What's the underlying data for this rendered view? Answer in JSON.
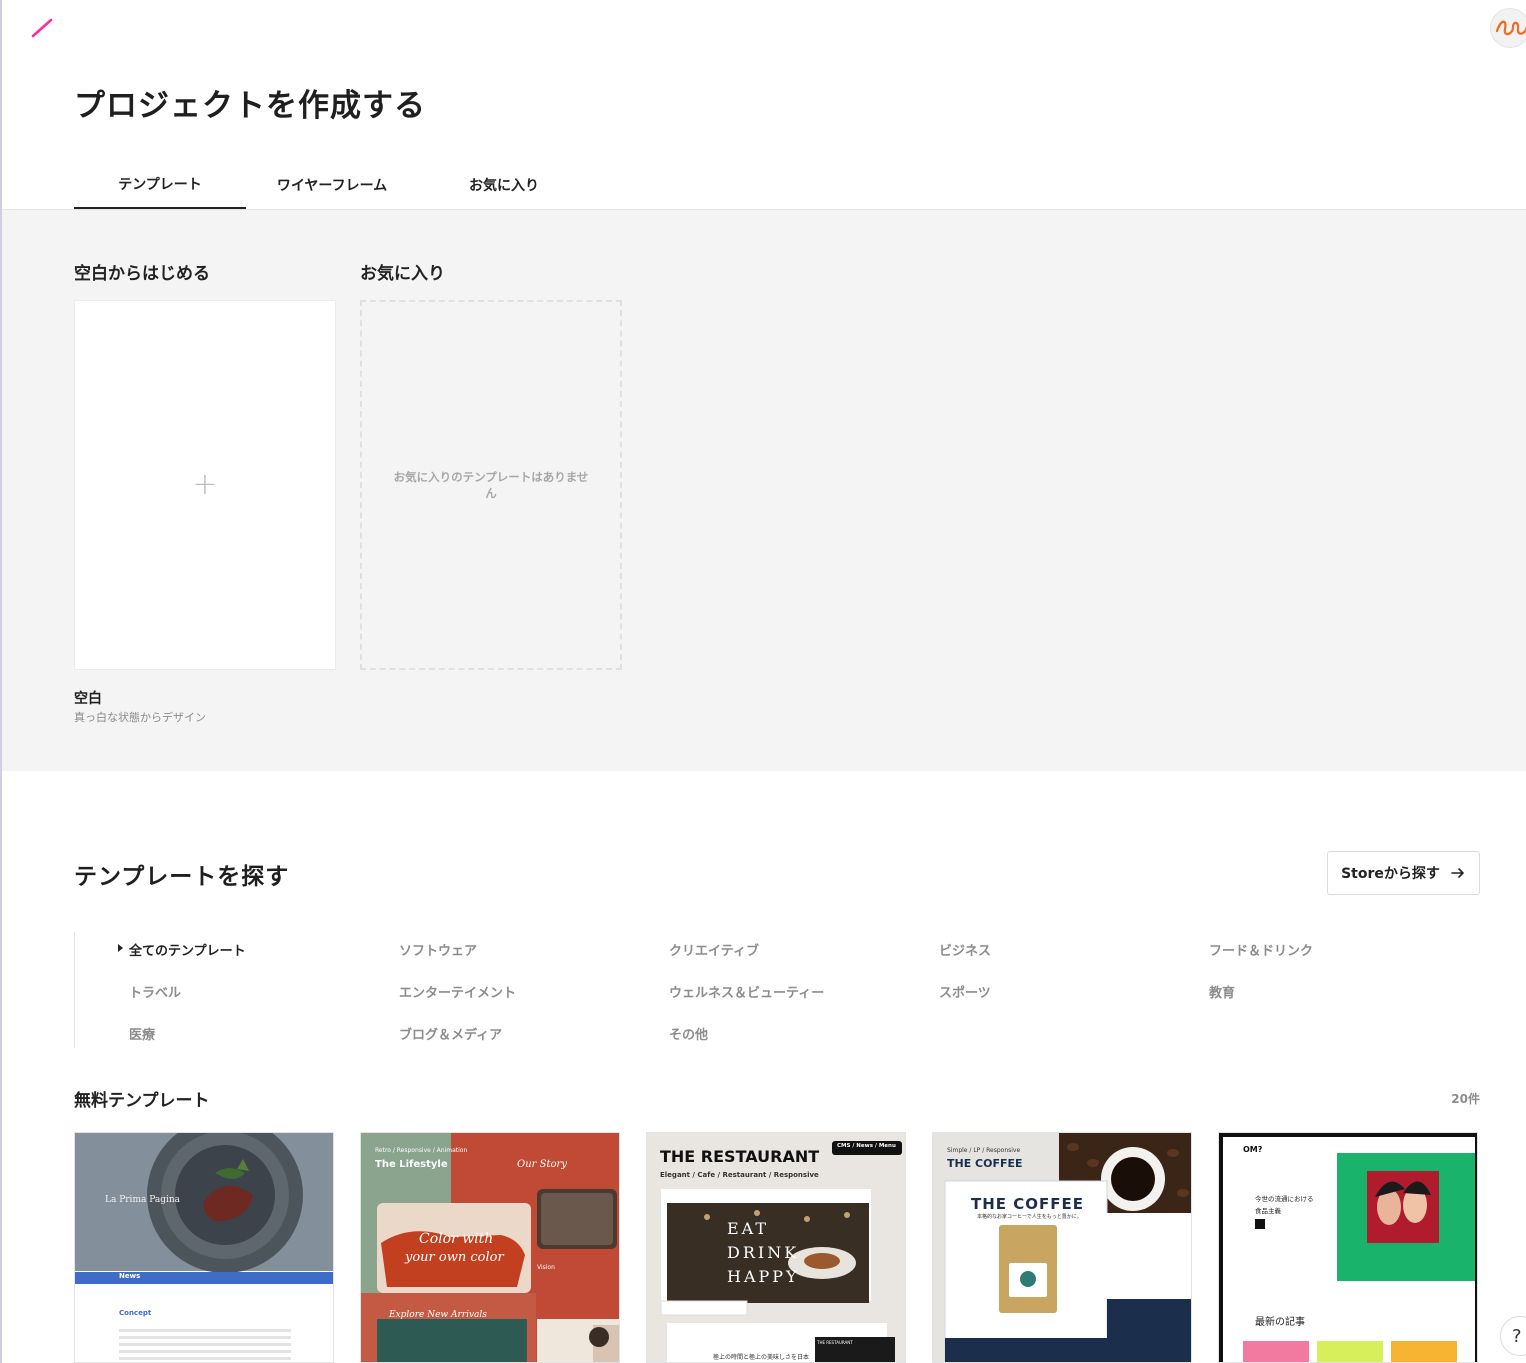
{
  "header": {
    "title": "プロジェクトを作成する"
  },
  "colors": {
    "logo_accent": "#ff2d9b",
    "avatar_accent": "#f26a1b",
    "gray_band": "#f4f4f4"
  },
  "tabs": [
    {
      "label": "テンプレート",
      "active": true
    },
    {
      "label": "ワイヤーフレーム",
      "active": false
    },
    {
      "label": "お気に入り",
      "active": false
    }
  ],
  "start_section": {
    "heading": "空白からはじめる",
    "card_icon": "plus-icon",
    "card_title": "空白",
    "card_subtitle": "真っ白な状態からデザイン"
  },
  "favorites_section": {
    "heading": "お気に入り",
    "empty_text": "お気に入りのテンプレートはありません"
  },
  "explore": {
    "title": "テンプレートを探す",
    "store_button": "Storeから探す",
    "store_icon": "arrow-right-icon"
  },
  "categories": [
    {
      "label": "全てのテンプレート",
      "active": true
    },
    {
      "label": "ソフトウェア"
    },
    {
      "label": "クリエイティブ"
    },
    {
      "label": "ビジネス"
    },
    {
      "label": "フード＆ドリンク"
    },
    {
      "label": "トラベル"
    },
    {
      "label": "エンターテイメント"
    },
    {
      "label": "ウェルネス＆ビューティー"
    },
    {
      "label": "スポーツ"
    },
    {
      "label": "教育"
    },
    {
      "label": "医療"
    },
    {
      "label": "ブログ＆メディア"
    },
    {
      "label": "その他"
    }
  ],
  "free_templates": {
    "title": "無料テンプレート",
    "count": "20件",
    "items": [
      {
        "brand": "La Prima Pagina",
        "news_label": "News",
        "section": "Concept"
      },
      {
        "tags": "Retro / Responsive / Animation",
        "title": "The Lifestyle",
        "script_1": "Color with",
        "script_2": "your own color",
        "script_3": "Our Story",
        "script_4": "Explore New Arrivals",
        "script_5": "Vision"
      },
      {
        "title": "THE RESTAURANT",
        "tags": "Elegant / Cafe / Restaurant / Responsive",
        "badge": "CMS / News / Menu",
        "hero_1": "EAT",
        "hero_2": "DRINK",
        "hero_3": "HAPPY",
        "caption": "極上の時間と極上の美味しさを日本",
        "subhead": "THE RESTAURANT"
      },
      {
        "tags": "Simple / LP / Responsive",
        "title": "THE COFFEE",
        "inner_title": "THE COFFEE",
        "inner_sub": "本格的なお家コーヒーで人生をもっと豊かに。"
      },
      {
        "logo": "OM?",
        "caption_1": "今世の流通における",
        "caption_2": "食品主義",
        "section": "最新の記事"
      }
    ]
  },
  "help": {
    "label": "?"
  }
}
